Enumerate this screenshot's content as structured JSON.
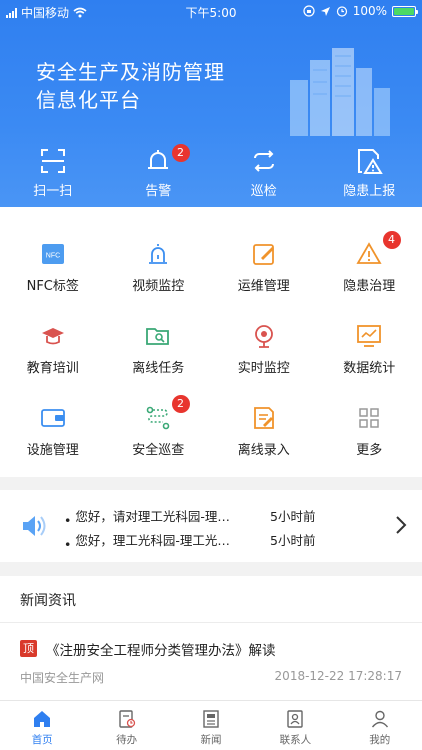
{
  "status": {
    "carrier": "中国移动",
    "time": "下午5:00",
    "battery": "100%"
  },
  "hero": {
    "title_line1": "安全生产及消防管理",
    "title_line2": "信息化平台"
  },
  "quick_actions": [
    {
      "label": "扫一扫",
      "icon": "scan-icon"
    },
    {
      "label": "告警",
      "icon": "bell-icon",
      "badge": "2"
    },
    {
      "label": "巡检",
      "icon": "repeat-icon"
    },
    {
      "label": "隐患上报",
      "icon": "hazard-report-icon"
    }
  ],
  "grid": [
    {
      "label": "NFC标签",
      "icon": "nfc-icon",
      "icon_text": "NFC"
    },
    {
      "label": "视频监控",
      "icon": "alarm-light-icon"
    },
    {
      "label": "运维管理",
      "icon": "edit-icon"
    },
    {
      "label": "隐患治理",
      "icon": "warning-icon",
      "badge": "4"
    },
    {
      "label": "教育培训",
      "icon": "graduation-cap-icon"
    },
    {
      "label": "离线任务",
      "icon": "folder-search-icon"
    },
    {
      "label": "实时监控",
      "icon": "webcam-icon"
    },
    {
      "label": "数据统计",
      "icon": "chart-icon"
    },
    {
      "label": "设施管理",
      "icon": "wallet-icon"
    },
    {
      "label": "安全巡查",
      "icon": "route-icon",
      "badge": "2"
    },
    {
      "label": "离线录入",
      "icon": "document-edit-icon"
    },
    {
      "label": "更多",
      "icon": "more-grid-icon"
    }
  ],
  "notices": [
    {
      "text": "您好，请对理工光科园-理…",
      "time": "5小时前"
    },
    {
      "text": "您好，理工光科园-理工光…",
      "time": "5小时前"
    }
  ],
  "news": {
    "heading": "新闻资讯",
    "top_tag": "顶",
    "title": "《注册安全工程师分类管理办法》解读",
    "source": "中国安全生产网",
    "date": "2018-12-22 17:28:17"
  },
  "tabs": [
    {
      "label": "首页",
      "icon": "home-icon",
      "active": true
    },
    {
      "label": "待办",
      "icon": "todo-icon"
    },
    {
      "label": "新闻",
      "icon": "news-icon"
    },
    {
      "label": "联系人",
      "icon": "contacts-icon"
    },
    {
      "label": "我的",
      "icon": "user-icon"
    }
  ],
  "colors": {
    "primary": "#2f7ff0",
    "badge": "#e8352e",
    "icon_blue": "#3b8ef0",
    "icon_orange": "#f0932b",
    "icon_red": "#d9534f",
    "icon_green": "#3aa876"
  }
}
